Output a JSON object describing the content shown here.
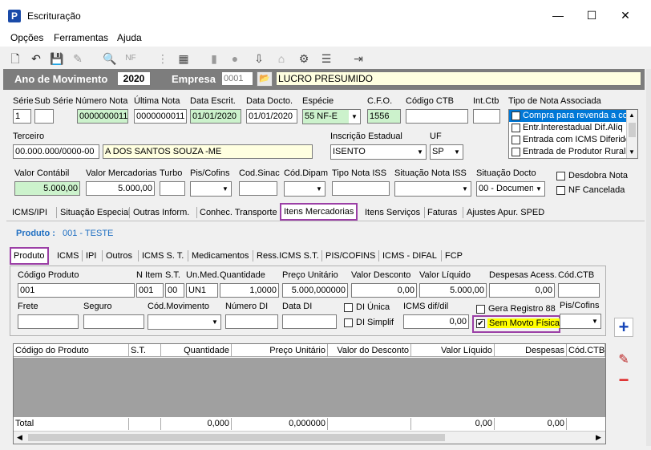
{
  "window": {
    "title": "Escrituração",
    "minimize": "—",
    "maximize": "☐",
    "close": "✕"
  },
  "menu": [
    "Opções",
    "Ferramentas",
    "Ajuda"
  ],
  "header": {
    "ano_label": "Ano de Movimento",
    "ano_value": "2020",
    "empresa_label": "Empresa",
    "empresa_code": "0001",
    "empresa_name": "LUCRO PRESUMIDO"
  },
  "row1": {
    "labels": {
      "serie": "Série",
      "subserie": "Sub Série",
      "numero": "Número Nota",
      "ultima": "Última Nota",
      "data_escrit": "Data Escrit.",
      "data_docto": "Data Docto.",
      "especie": "Espécie",
      "cfo": "C.F.O.",
      "codigo_ctb": "Código CTB",
      "int_ctb": "Int.Ctb",
      "tipo_nota": "Tipo de Nota Associada"
    },
    "values": {
      "serie": "1",
      "subserie": "",
      "numero": "0000000011",
      "ultima": "0000000011",
      "data_escrit": "01/01/2020",
      "data_docto": "01/01/2020",
      "especie": "55  NF-E",
      "cfo": "1556",
      "codigo_ctb": "",
      "int_ctb": ""
    },
    "tipo_nota_options": [
      "Compra para revenda a co",
      "Entr.Interestadual Dif.Alíq",
      "Entrada com ICMS Diferido",
      "Entrada de Produtor Rural"
    ]
  },
  "row2": {
    "terceiro_label": "Terceiro",
    "terceiro_code": "00.000.000/0000-00",
    "terceiro_name": "A DOS SANTOS SOUZA -ME",
    "ie_label": "Inscrição Estadual",
    "ie_value": "ISENTO",
    "uf_label": "UF",
    "uf_value": "SP"
  },
  "row3": {
    "labels": {
      "valor_contabil": "Valor Contábil",
      "valor_merc": "Valor Mercadorias",
      "turbo": "Turbo",
      "pis": "Pis/Cofins",
      "cod_sinac": "Cod.Sinac",
      "cod_dipam": "Cód.Dipam",
      "tipo_iss": "Tipo Nota ISS",
      "situacao_iss": "Situação Nota ISS",
      "situacao_docto": "Situação Docto",
      "desdobra": "Desdobra Nota",
      "nf_cancelada": "NF Cancelada"
    },
    "values": {
      "valor_contabil": "5.000,00",
      "valor_merc": "5.000,00",
      "situacao_docto": "00 - Documen"
    }
  },
  "main_tabs": [
    "ICMS/IPI",
    "Situação Especial",
    "Outras Inform.",
    "Conhec. Transporte",
    "Itens Mercadorias",
    "Itens Serviços",
    "Faturas",
    "Ajustes Apur. SPED"
  ],
  "produto": {
    "label": "Produto :",
    "value": "001 - TESTE"
  },
  "sub_tabs": [
    "Produto",
    "ICMS",
    "IPI",
    "Outros",
    "ICMS S. T.",
    "Medicamentos",
    "Ress.ICMS S.T.",
    "PIS/COFINS",
    "ICMS - DIFAL",
    "FCP"
  ],
  "prod_row1": {
    "labels": {
      "codigo": "Código Produto",
      "nitem": "N Item",
      "st": "S.T.",
      "unmed": "Un.Med.",
      "quantidade": "Quantidade",
      "preco": "Preço Unitário",
      "desconto": "Valor Desconto",
      "liquido": "Valor Líquido",
      "despesas": "Despesas Acess.",
      "codctb": "Cód.CTB"
    },
    "values": {
      "codigo": "001",
      "nitem": "001",
      "st": "00",
      "unmed": "UN1",
      "quantidade": "1,0000",
      "preco": "5.000,000000",
      "desconto": "0,00",
      "liquido": "5.000,00",
      "despesas": "0,00",
      "codctb": ""
    }
  },
  "prod_row2": {
    "labels": {
      "frete": "Frete",
      "seguro": "Seguro",
      "cod_mov": "Cód.Movimento",
      "numero_di": "Número DI",
      "data_di": "Data DI",
      "di_unica": "DI Única",
      "di_simplif": "DI Simplif",
      "icms_dif": "ICMS dif/dil",
      "gera_registro": "Gera Registro 88",
      "sem_movto": "Sem Movto Física",
      "pis_cofins": "Pis/Cofins"
    },
    "values": {
      "icms_dif": "0,00"
    }
  },
  "grid": {
    "headers": [
      "Código do Produto",
      "S.T.",
      "Quantidade",
      "Preço Unitário",
      "Valor do Desconto",
      "Valor Líquido",
      "Despesas",
      "Cód.CTB"
    ],
    "totals": [
      "Total",
      "",
      "0,000",
      "0,000000",
      "",
      "0,00",
      "0,00",
      ""
    ]
  },
  "icons": {
    "add": "plus-icon",
    "edit": "pencil-icon",
    "remove": "minus-icon"
  },
  "colors": {
    "header_bar": "#7d7d7d",
    "highlight": "#9b3fa6",
    "green_field": "#ccf2cc",
    "yellow_field": "#ffffe0",
    "selected_option": "#0078d7",
    "sem_movto_bg": "#ffff00"
  }
}
